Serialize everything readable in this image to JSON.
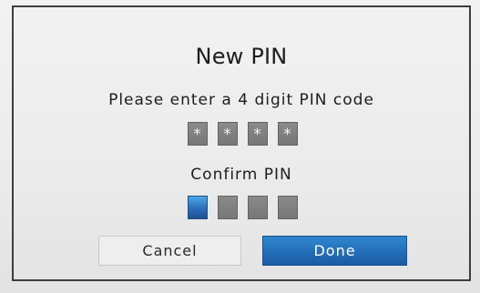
{
  "dialog": {
    "title": "New PIN",
    "enter_prompt": "Please enter a 4 digit PIN code",
    "confirm_prompt": "Confirm PIN",
    "pin_entry": [
      "*",
      "*",
      "*",
      "*"
    ],
    "pin_confirm": [
      "",
      "",
      "",
      ""
    ],
    "cancel_label": "Cancel",
    "done_label": "Done"
  },
  "colors": {
    "accent": "#1f6fc0",
    "active_field": "#2a6fb8"
  }
}
